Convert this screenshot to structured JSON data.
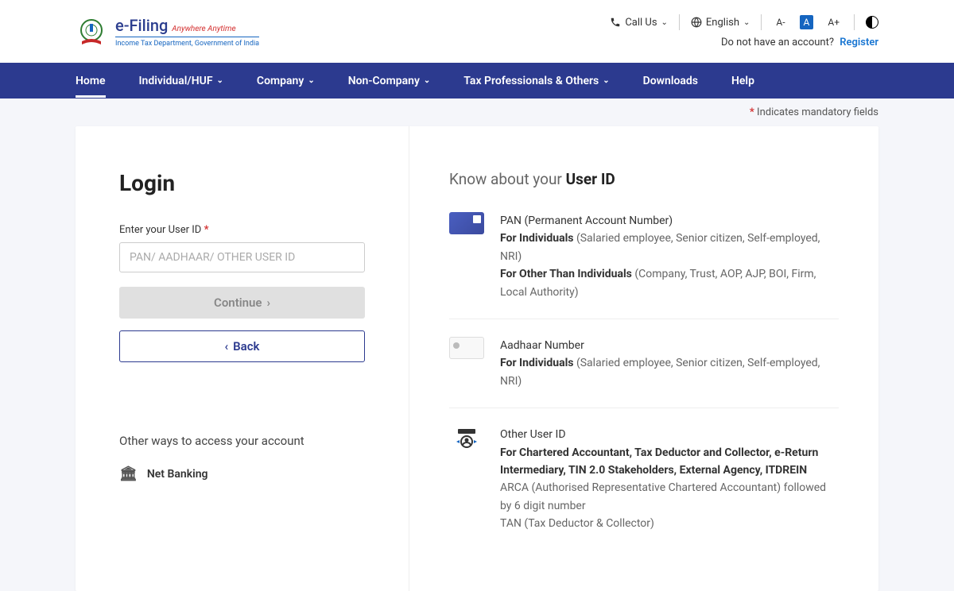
{
  "header": {
    "brand": "e-Filing",
    "tagline": "Anywhere Anytime",
    "subtitle": "Income Tax Department, Government of India",
    "call_us": "Call Us",
    "language": "English",
    "no_account": "Do not have an account?",
    "register": "Register",
    "font_small": "A-",
    "font_mid": "A",
    "font_large": "A+"
  },
  "nav": {
    "home": "Home",
    "individual": "Individual/HUF",
    "company": "Company",
    "noncompany": "Non-Company",
    "tax_pro": "Tax Professionals & Others",
    "downloads": "Downloads",
    "help": "Help"
  },
  "mandatory": "Indicates mandatory fields",
  "login": {
    "title": "Login",
    "label": "Enter your User ID",
    "placeholder": "PAN/ AADHAAR/ OTHER USER ID",
    "continue": "Continue",
    "back": "Back",
    "other_ways": "Other ways to access your account",
    "netbanking": "Net Banking"
  },
  "know": {
    "prefix": "Know about your ",
    "bold": "User ID",
    "pan_title": "PAN (Permanent Account Number)",
    "pan_ind_bold": "For Individuals",
    "pan_ind_rest": " (Salaried employee, Senior citizen, Self-employed, NRI)",
    "pan_oth_bold": "For Other Than Individuals",
    "pan_oth_rest": " (Company, Trust, AOP, AJP, BOI, Firm, Local Authority)",
    "aad_title": "Aadhaar Number",
    "aad_ind_bold": "For Individuals",
    "aad_ind_rest": " (Salaried employee, Senior citizen, Self-employed, NRI)",
    "oth_title": "Other User ID",
    "oth_bold": "For Chartered Accountant, Tax Deductor and Collector, e-Return Intermediary, TIN 2.0 Stakeholders, External Agency, ITDREIN",
    "oth_line1": "ARCA (Authorised Representative Chartered Accountant) followed by 6 digit number",
    "oth_line2": "TAN (Tax Deductor & Collector)"
  }
}
